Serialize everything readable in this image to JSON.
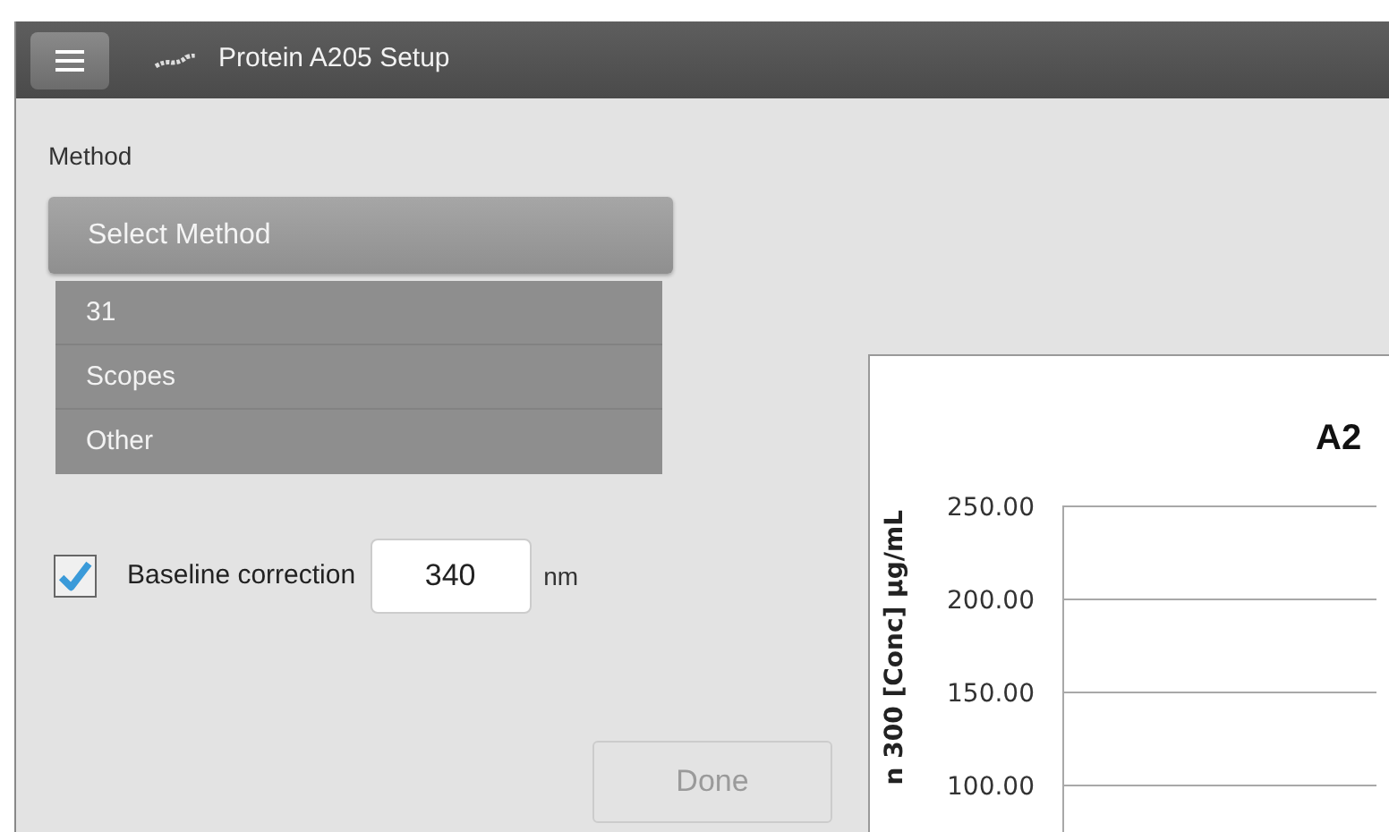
{
  "window": {
    "title": "Protein A205 Setup"
  },
  "method": {
    "label": "Method",
    "select": "Select Method",
    "options": [
      {
        "label": "31"
      },
      {
        "label": "Scopes"
      },
      {
        "label": "Other"
      }
    ]
  },
  "baseline": {
    "label": "Baseline correction",
    "checked": true,
    "value": "340",
    "unit": "nm"
  },
  "done": {
    "label": "Done",
    "disabled": true
  },
  "chart": {
    "title": "A2",
    "ylabel": "n 300 [Conc] µg/mL",
    "tick_labels": [
      "250.00",
      "200.00",
      "150.00",
      "100.00"
    ]
  }
}
